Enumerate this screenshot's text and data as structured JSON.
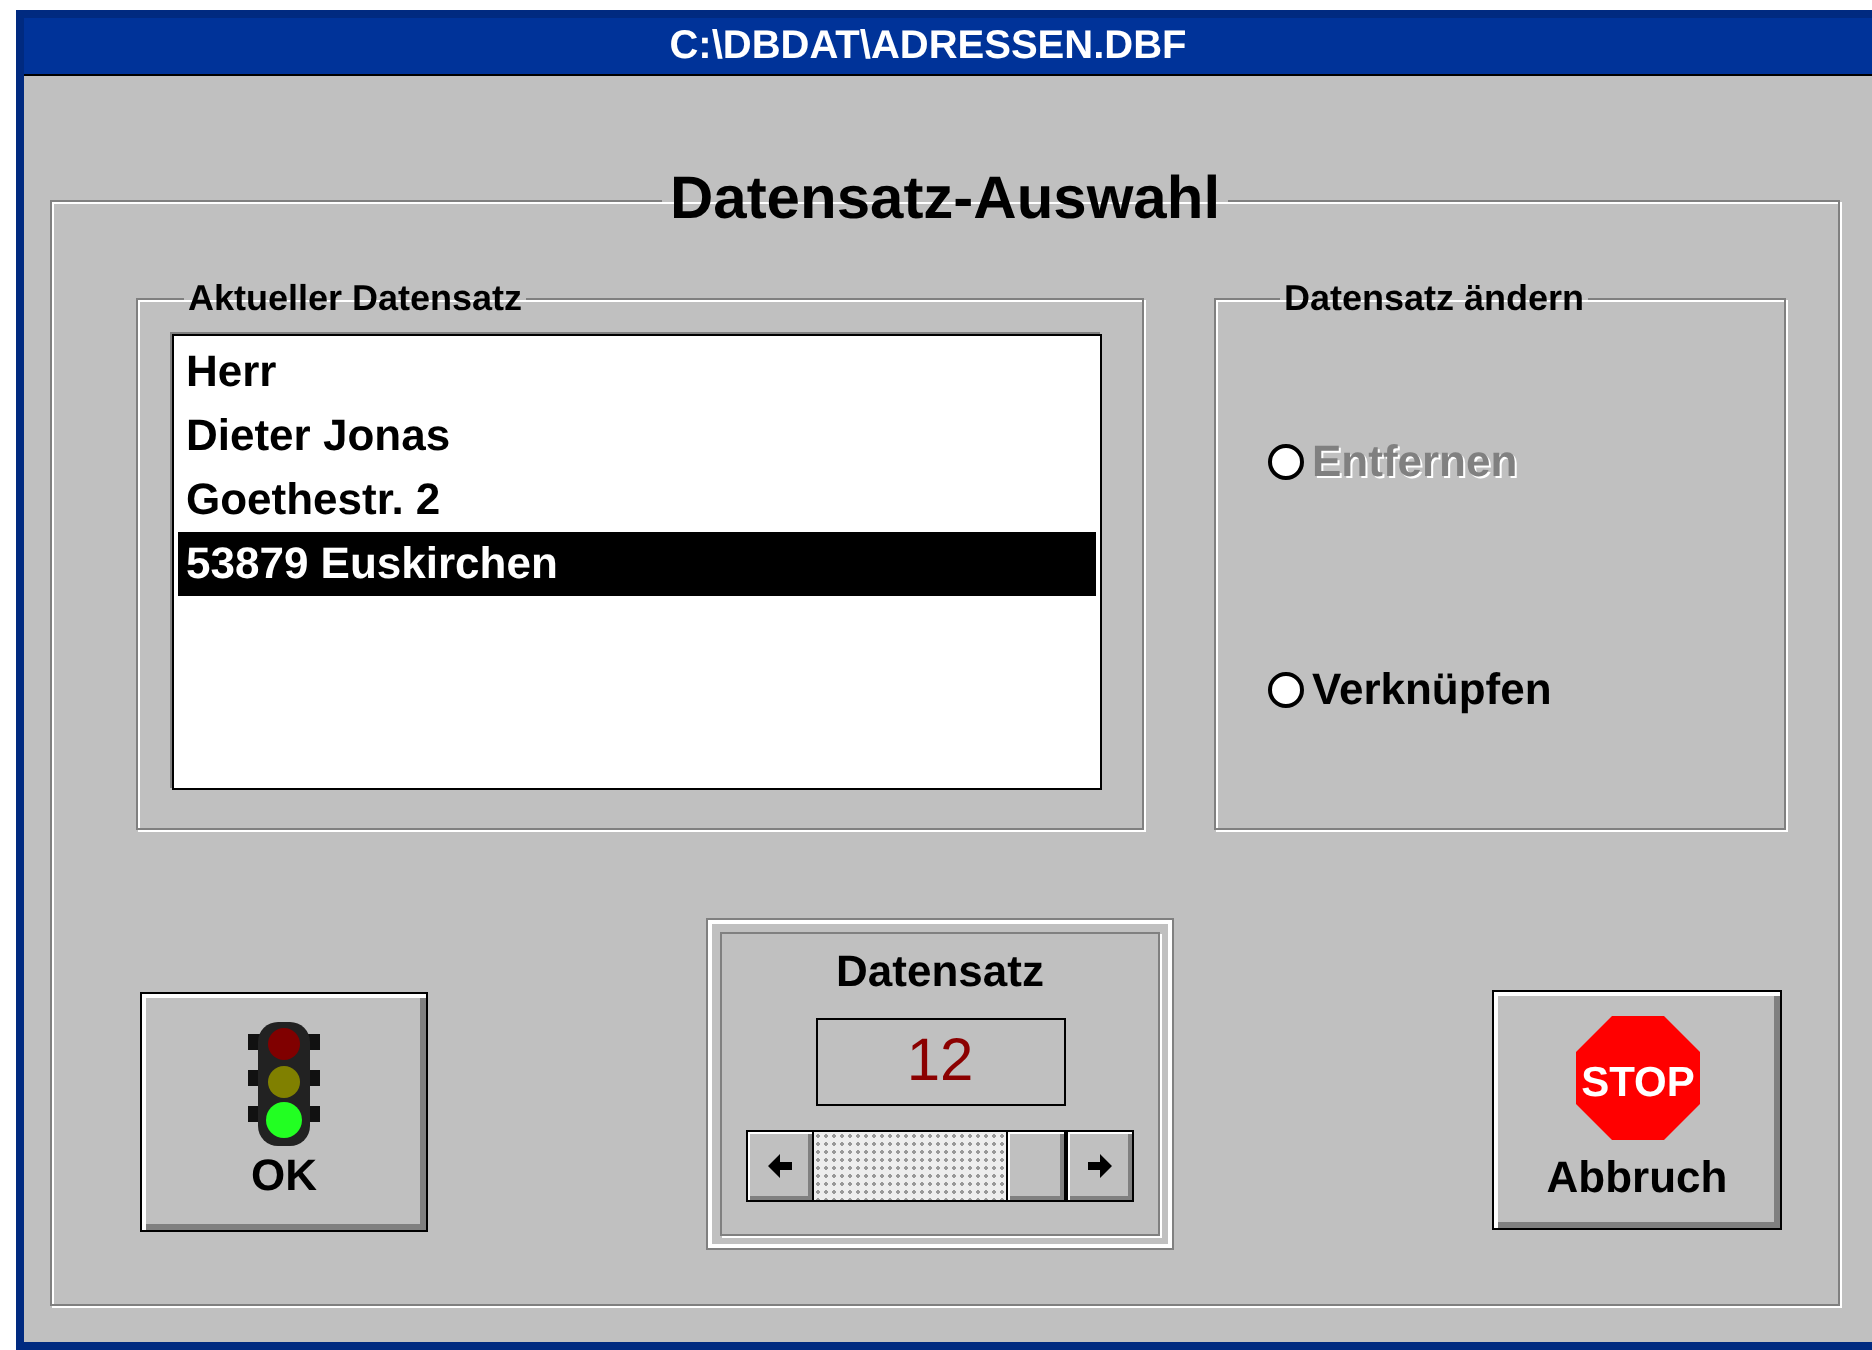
{
  "window": {
    "title": "C:\\DBDAT\\ADRESSEN.DBF"
  },
  "dialog_title": "Datensatz-Auswahl",
  "current_record": {
    "label": "Aktueller Datensatz",
    "lines": [
      {
        "text": "Herr",
        "selected": false
      },
      {
        "text": "Dieter Jonas",
        "selected": false
      },
      {
        "text": "Goethestr. 2",
        "selected": false
      },
      {
        "text": "53879 Euskirchen",
        "selected": true
      }
    ]
  },
  "change_record": {
    "label": "Datensatz ändern",
    "options": [
      {
        "label": "Entfernen",
        "selected": false,
        "disabled": true
      },
      {
        "label": "Verknüpfen",
        "selected": false,
        "disabled": false
      }
    ]
  },
  "ok_button": {
    "label": "OK"
  },
  "record_navigator": {
    "label": "Datensatz",
    "value": "12"
  },
  "cancel_button": {
    "label": "Abbruch",
    "sign_text": "STOP"
  }
}
